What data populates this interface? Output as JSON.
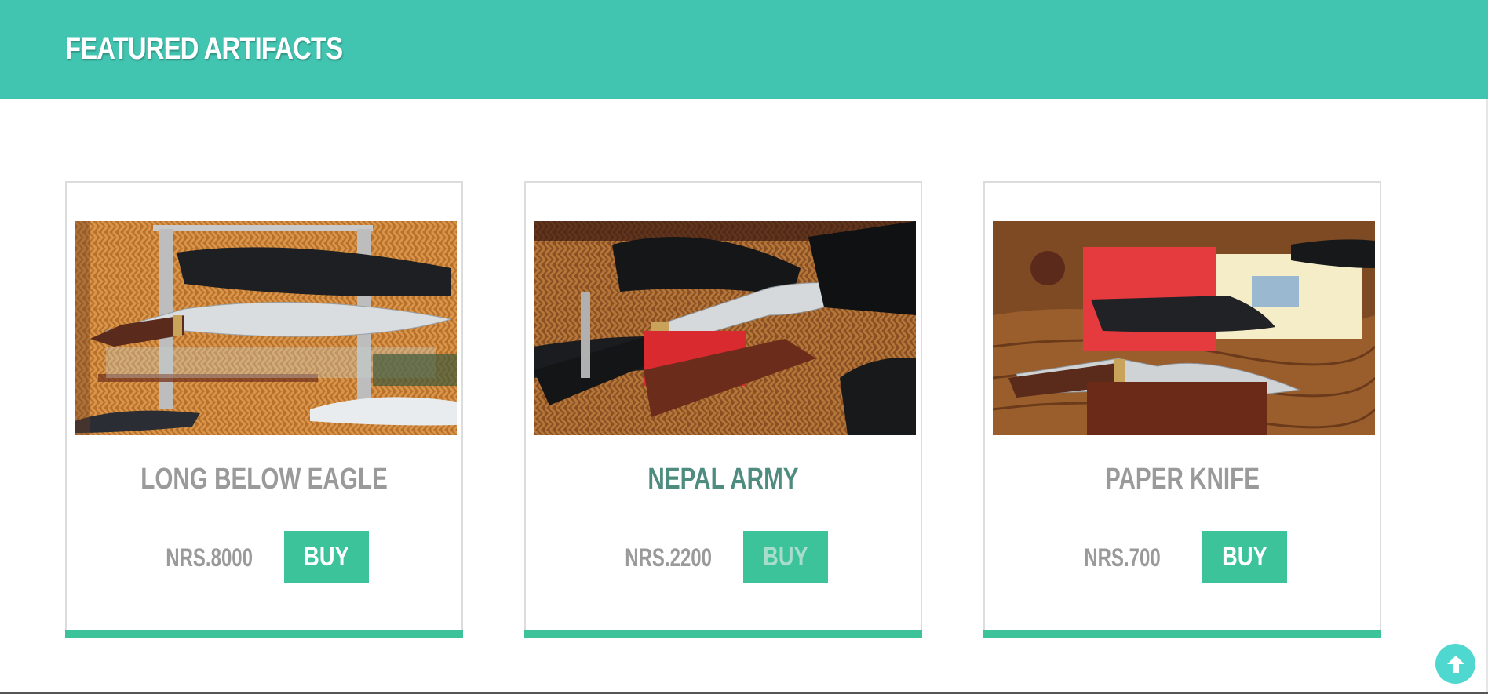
{
  "header": {
    "title": "FEATURED ARTIFACTS"
  },
  "products": [
    {
      "name": "LONG BELOW EAGLE",
      "price": "NRS.8000",
      "buy_label": "BUY",
      "image_icon": "khukuri-display-photo"
    },
    {
      "name": "NEPAL ARMY",
      "price": "NRS.2200",
      "buy_label": "BUY",
      "image_icon": "khukuri-display-photo"
    },
    {
      "name": "PAPER KNIFE",
      "price": "NRS.700",
      "buy_label": "BUY",
      "image_icon": "khukuri-display-photo"
    }
  ],
  "colors": {
    "header_bg": "#41c4b0",
    "accent": "#3cc39a",
    "title_gray": "#9a9a9a",
    "title_active": "#4f8c80",
    "scroll_button": "#4fd8cf"
  },
  "scroll_top": {
    "icon": "arrow-up-icon"
  }
}
